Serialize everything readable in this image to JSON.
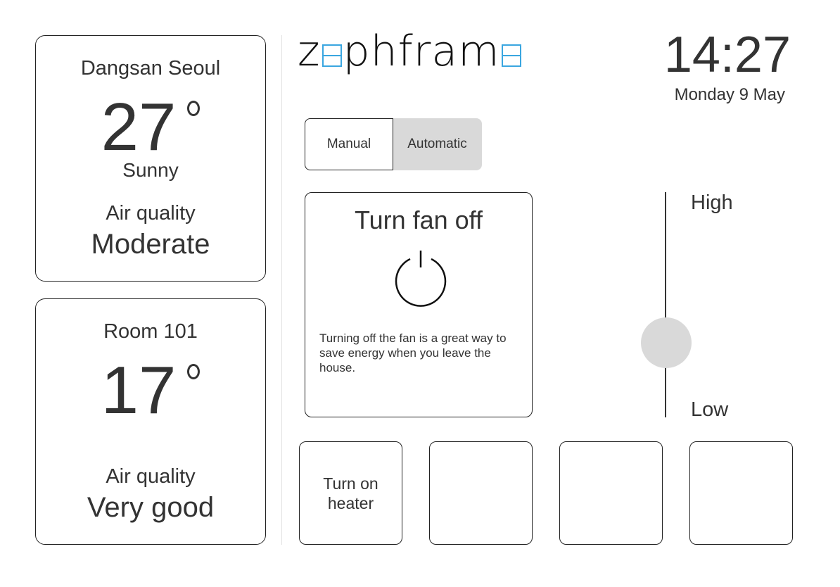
{
  "brand": {
    "logo_parts": [
      "z",
      "phfram"
    ],
    "accent_color": "#3aa6e0"
  },
  "clock": {
    "time": "14:27",
    "date": "Monday 9 May"
  },
  "outdoor": {
    "location": "Dangsan Seoul",
    "temperature": "27",
    "condition": "Sunny",
    "air_quality_label": "Air quality",
    "air_quality_value": "Moderate"
  },
  "room": {
    "name": "Room 101",
    "temperature": "17",
    "air_quality_label": "Air quality",
    "air_quality_value": "Very good"
  },
  "mode": {
    "manual_label": "Manual",
    "automatic_label": "Automatic",
    "selected": "Automatic"
  },
  "fan": {
    "title": "Turn fan off",
    "icon": "power-icon",
    "description": "Turning off the fan is a great way to save energy when you leave the house."
  },
  "speed_slider": {
    "high_label": "High",
    "low_label": "Low",
    "level": 0.33
  },
  "tiles": [
    {
      "label": "Turn on heater"
    },
    {
      "label": ""
    },
    {
      "label": ""
    },
    {
      "label": ""
    }
  ]
}
